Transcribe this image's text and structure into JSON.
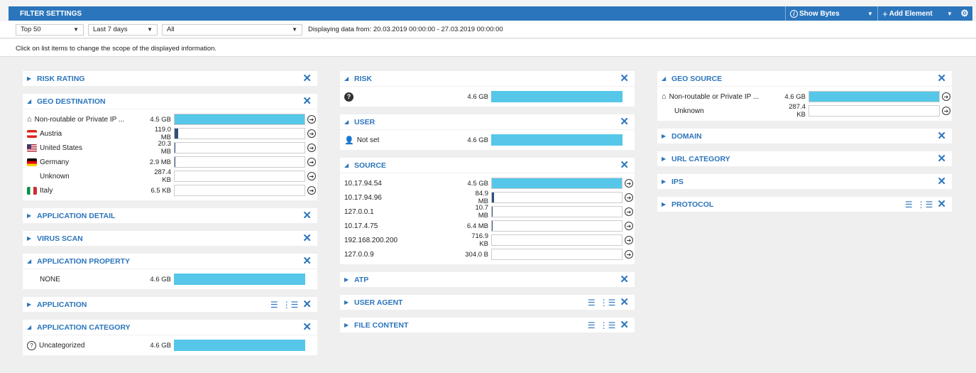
{
  "header": {
    "title": "FILTER SETTINGS",
    "show_bytes": "Show Bytes",
    "add_element": "Add Element"
  },
  "filters": {
    "top": "Top 50",
    "period": "Last 7 days",
    "scope": "All",
    "displaying": "Displaying data from: 20.03.2019 00:00:00 - 27.03.2019 00:00:00"
  },
  "hint": "Click on list items to change the scope of the displayed information.",
  "col1": {
    "risk_rating": "RISK RATING",
    "geo_destination": {
      "title": "GEO DESTINATION",
      "rows": [
        {
          "name": "Non-routable or Private IP ...",
          "size": "4.5 GB",
          "pct": 100,
          "icon": "home-icon"
        },
        {
          "name": "Austria",
          "size": "119.0 MB",
          "pct": 2.6,
          "icon": "flag-austria-icon"
        },
        {
          "name": "United States",
          "size": "20.3 MB",
          "pct": 0.5,
          "icon": "flag-us-icon"
        },
        {
          "name": "Germany",
          "size": "2.9 MB",
          "pct": 0.1,
          "icon": "flag-germany-icon"
        },
        {
          "name": "Unknown",
          "size": "287.4 KB",
          "pct": 0,
          "icon": ""
        },
        {
          "name": "Italy",
          "size": "6.5 KB",
          "pct": 0,
          "icon": "flag-italy-icon"
        }
      ]
    },
    "application_detail": "APPLICATION DETAIL",
    "virus_scan": "VIRUS SCAN",
    "application_property": {
      "title": "APPLICATION PROPERTY",
      "row_name": "NONE",
      "row_size": "4.6 GB"
    },
    "application": "APPLICATION",
    "application_category": {
      "title": "APPLICATION CATEGORY",
      "row_name": "Uncategorized",
      "row_size": "4.6 GB"
    }
  },
  "col2": {
    "risk": {
      "title": "RISK",
      "row_size": "4.6 GB"
    },
    "user": {
      "title": "USER",
      "row_name": "Not set",
      "row_size": "4.6 GB"
    },
    "source": {
      "title": "SOURCE",
      "rows": [
        {
          "name": "10.17.94.54",
          "size": "4.5 GB",
          "pct": 100
        },
        {
          "name": "10.17.94.96",
          "size": "84.9 MB",
          "pct": 1.8
        },
        {
          "name": "127.0.0.1",
          "size": "10.7 MB",
          "pct": 0.3
        },
        {
          "name": "10.17.4.75",
          "size": "6.4 MB",
          "pct": 0.1
        },
        {
          "name": "192.168.200.200",
          "size": "716.9 KB",
          "pct": 0
        },
        {
          "name": "127.0.0.9",
          "size": "304.0  B",
          "pct": 0
        }
      ]
    },
    "atp": "ATP",
    "user_agent": "USER AGENT",
    "file_content": "FILE CONTENT"
  },
  "col3": {
    "geo_source": {
      "title": "GEO SOURCE",
      "rows": [
        {
          "name": "Non-routable or Private IP ...",
          "size": "4.6 GB",
          "pct": 100
        },
        {
          "name": "Unknown",
          "size": "287.4 KB",
          "pct": 0
        }
      ]
    },
    "domain": "DOMAIN",
    "url_category": "URL CATEGORY",
    "ips": "IPS",
    "protocol": "PROTOCOL"
  },
  "colors": {
    "accent": "#2b75bc",
    "bar": "#56c7e8",
    "bar_small": "#2e4f7c"
  }
}
